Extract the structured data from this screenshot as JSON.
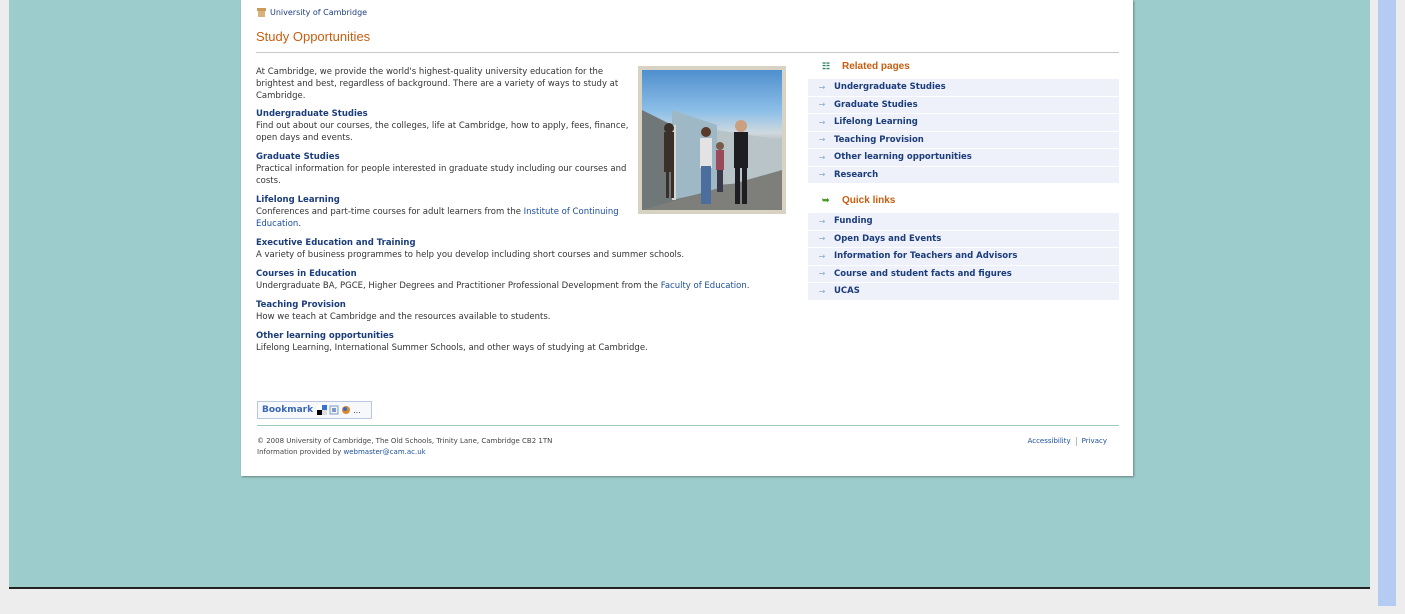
{
  "breadcrumb": {
    "label": "University of Cambridge"
  },
  "page": {
    "title": "Study Opportunities"
  },
  "intro": "At Cambridge, we provide the world's highest-quality university education for the brightest and best, regardless of background. There are a variety of ways to study at Cambridge.",
  "sections": [
    {
      "heading": "Undergraduate Studies",
      "text": "Find out about our courses, the colleges, life at Cambridge, how to apply, fees, finance, open days and events."
    },
    {
      "heading": "Graduate Studies",
      "text": "Practical information for people interested in graduate study including our courses and costs."
    },
    {
      "heading": "Lifelong Learning",
      "text": "Conferences and part-time courses for adult learners from the ",
      "link": "Institute of Continuing Education",
      "after": "."
    },
    {
      "heading": "Executive Education and Training",
      "text": "A variety of business programmes to help you develop including short courses and summer schools."
    },
    {
      "heading": "Courses in Education",
      "text": "Undergraduate BA, PGCE, Higher Degrees and Practitioner Professional Development from the ",
      "link": "Faculty of Education",
      "after": "."
    },
    {
      "heading": "Teaching Provision",
      "text": "How we teach at Cambridge and the resources available to students."
    },
    {
      "heading": "Other learning opportunities",
      "text": "Lifelong Learning, International Summer Schools, and other ways of studying at Cambridge."
    }
  ],
  "sidebar": {
    "related": {
      "title": "Related pages",
      "items": [
        "Undergraduate Studies",
        "Graduate Studies",
        "Lifelong Learning",
        "Teaching Provision",
        "Other learning opportunities",
        "Research"
      ]
    },
    "quick": {
      "title": "Quick links",
      "items": [
        "Funding",
        "Open Days and Events",
        "Information for Teachers and Advisors",
        "Course and student facts and figures",
        "UCAS"
      ]
    },
    "arrow": "→"
  },
  "bookmark": {
    "label": "Bookmark",
    "more": "..."
  },
  "footer": {
    "copyright": "© 2008 University of Cambridge, The Old Schools, Trinity Lane, Cambridge CB2 1TN",
    "provided": "Information provided by ",
    "email": "webmaster@cam.ac.uk",
    "accessibility": "Accessibility",
    "privacy": "Privacy"
  },
  "icons": {
    "crumb": "university-crest-icon",
    "related": "list-icon",
    "quick": "leaf-arrow-icon"
  }
}
